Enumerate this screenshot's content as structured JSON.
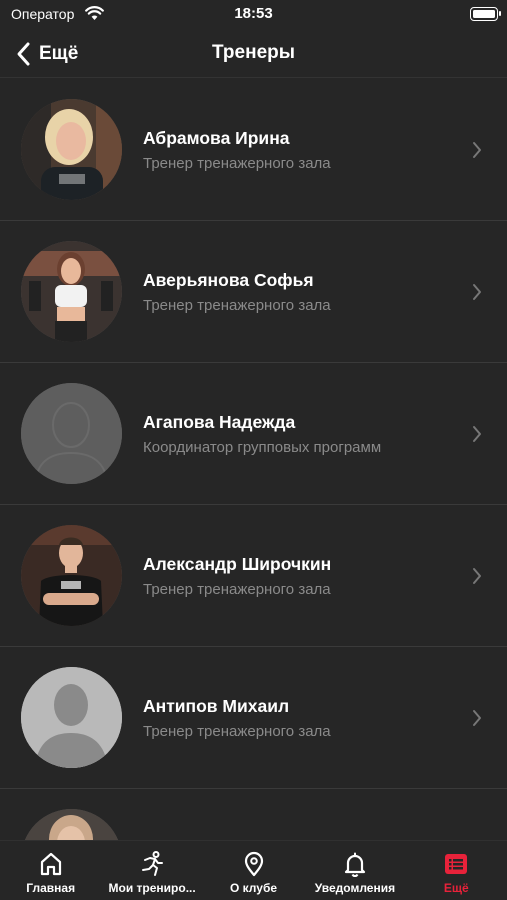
{
  "status_bar": {
    "carrier": "Оператор",
    "time": "18:53"
  },
  "nav": {
    "back_label": "Ещё",
    "title": "Тренеры"
  },
  "trainers": [
    {
      "name": "Абрамова Ирина",
      "role": "Тренер тренажерного зала",
      "avatar": "photo-blonde-woman"
    },
    {
      "name": "Аверьянова Софья",
      "role": "Тренер тренажерного зала",
      "avatar": "photo-woman-gym"
    },
    {
      "name": "Агапова Надежда",
      "role": "Координатор групповых программ",
      "avatar": "placeholder-silhouette"
    },
    {
      "name": "Александр Широчкин",
      "role": "Тренер тренажерного зала",
      "avatar": "photo-man-crossed-arms"
    },
    {
      "name": "Антипов Михаил",
      "role": "Тренер тренажерного зала",
      "avatar": "placeholder-silhouette"
    }
  ],
  "tabs": [
    {
      "label": "Главная",
      "icon": "home-icon",
      "active": false
    },
    {
      "label": "Мои трениро...",
      "icon": "running-person-icon",
      "active": false
    },
    {
      "label": "О клубе",
      "icon": "location-pin-icon",
      "active": false
    },
    {
      "label": "Уведомления",
      "icon": "bell-icon",
      "active": false
    },
    {
      "label": "Ещё",
      "icon": "list-icon",
      "active": true
    }
  ],
  "colors": {
    "background": "#262626",
    "accent": "#e8223a",
    "secondary_text": "#8a8a8a"
  }
}
